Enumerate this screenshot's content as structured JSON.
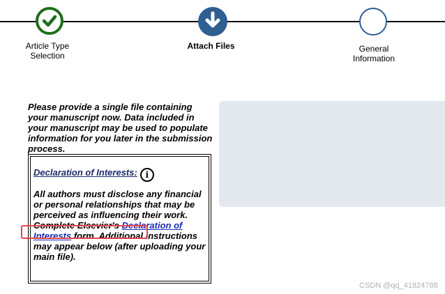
{
  "stepper": {
    "steps": [
      {
        "label_line1": "Article Type",
        "label_line2": "Selection",
        "state": "completed",
        "icon": "check-icon"
      },
      {
        "label": "Attach Files",
        "state": "current",
        "icon": "arrow-down-icon"
      },
      {
        "label_line1": "General",
        "label_line2": "Information",
        "state": "upcoming"
      }
    ],
    "colors": {
      "completed": "#1e6e1a",
      "current": "#2f5e91",
      "line": "#000000"
    }
  },
  "main": {
    "intro_text": "Please provide a single file containing your manuscript now. Data included in your manuscript may be used to populate information for you later in the submission process.",
    "declaration": {
      "heading": "Declaration of Interests:",
      "info_icon": "info-icon",
      "body_before_link": "All authors must disclose any financial or personal relationships that may be perceived as influencing their work. Complete Elsevier's",
      "link_text": "Declaration of Interests",
      "body_after_link": "form. Additional instructions may appear below (after uploading your main file)."
    },
    "highlight_color": "#e5444f",
    "upload_panel_color": "#e3e9ef"
  },
  "watermark": "CSDN @qq_41824788"
}
